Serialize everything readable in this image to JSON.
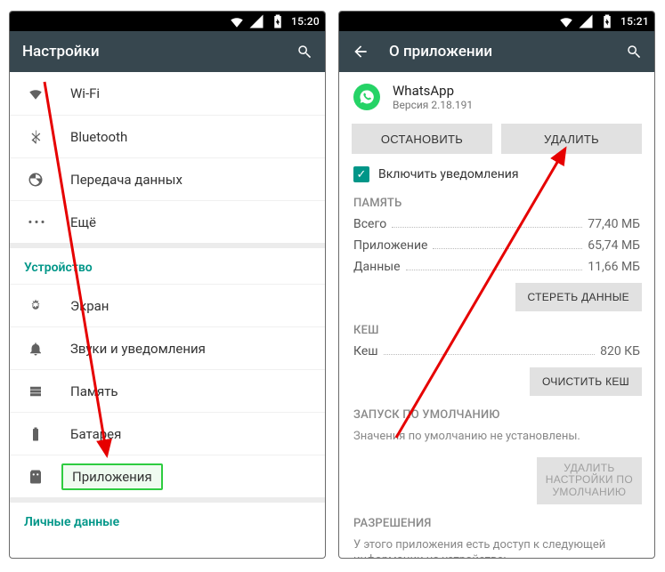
{
  "left": {
    "status_time": "15:20",
    "title": "Настройки",
    "rows": {
      "wifi": "Wi-Fi",
      "bluetooth": "Bluetooth",
      "data": "Передача данных",
      "more": "Ещё"
    },
    "device_header": "Устройство",
    "device_rows": {
      "display": "Экран",
      "sound": "Звуки и уведомления",
      "storage": "Память",
      "battery": "Батарея",
      "apps": "Приложения"
    },
    "personal_header": "Личные данные"
  },
  "right": {
    "status_time": "15:21",
    "title": "О приложении",
    "app_name": "WhatsApp",
    "app_version": "Версия 2.18.191",
    "btn_stop": "ОСТАНОВИТЬ",
    "btn_delete": "УДАЛИТЬ",
    "notif_label": "Включить уведомления",
    "mem_header": "ПАМЯТЬ",
    "mem": {
      "total_k": "Всего",
      "total_v": "77,40 МБ",
      "app_k": "Приложение",
      "app_v": "65,74 МБ",
      "data_k": "Данные",
      "data_v": "11,66 МБ"
    },
    "btn_erase_data": "СТЕРЕТЬ ДАННЫЕ",
    "cache_header": "КЕШ",
    "cache_k": "Кеш",
    "cache_v": "820 КБ",
    "btn_clear_cache": "ОЧИСТИТЬ КЕШ",
    "launch_header": "ЗАПУСК ПО УМОЛЧАНИЮ",
    "launch_note": "Значения по умолчанию не установлены.",
    "btn_reset_defaults_l1": "УДАЛИТЬ",
    "btn_reset_defaults_l2": "НАСТРОЙКИ ПО",
    "btn_reset_defaults_l3": "УМОЛЧАНИЮ",
    "perm_header": "РАЗРЕШЕНИЯ",
    "perm_note": "У этого приложения есть доступ к следующей информации на устройстве:"
  }
}
